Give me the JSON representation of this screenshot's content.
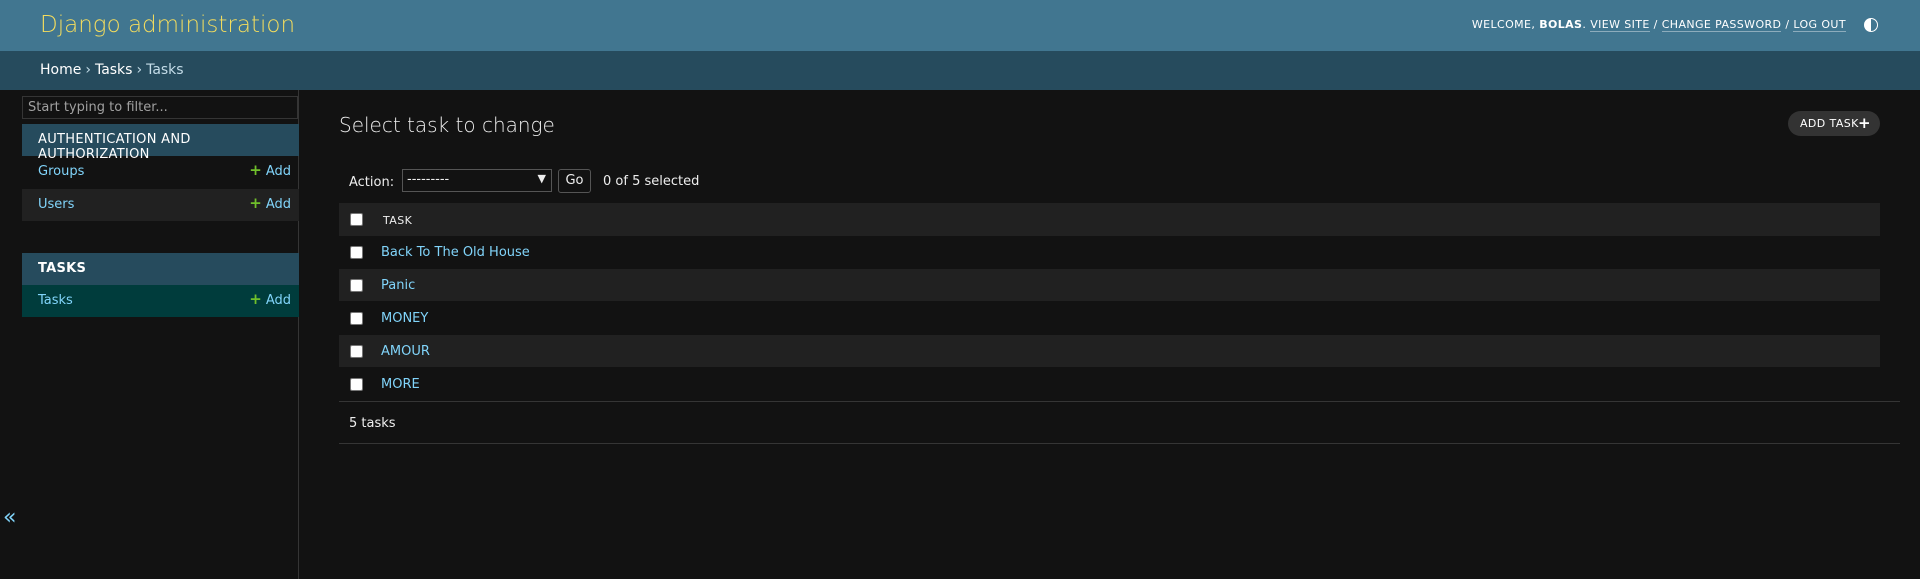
{
  "header": {
    "brand": "Django administration",
    "welcome": "WELCOME, ",
    "username": "BOLAS",
    "view_site": "VIEW SITE",
    "change_password": "CHANGE PASSWORD",
    "log_out": "LOG OUT",
    "separator": " / ",
    "theme_icon": "half-circle-theme-icon"
  },
  "breadcrumbs": [
    "Home",
    "Tasks",
    "Tasks"
  ],
  "breadcrumb_sep": "›",
  "sidebar": {
    "filter_placeholder": "Start typing to filter...",
    "modules": [
      {
        "caption": "AUTHENTICATION AND AUTHORIZATION",
        "models": [
          {
            "name": "Groups",
            "add": "Add"
          },
          {
            "name": "Users",
            "add": "Add"
          }
        ]
      },
      {
        "caption": "TASKS",
        "models": [
          {
            "name": "Tasks",
            "add": "Add",
            "current": true
          }
        ]
      }
    ],
    "collapse_icon": "«"
  },
  "content": {
    "title": "Select task to change",
    "add_button": "ADD TASK",
    "action_label": "Action:",
    "action_selected": "---------",
    "go": "Go",
    "counter": "0 of 5 selected",
    "column_header": "TASK",
    "rows": [
      "Back To The Old House",
      "Panic",
      "MONEY",
      "AMOUR",
      "MORE"
    ],
    "paginator": "5 tasks"
  },
  "colors": {
    "header_bg": "#417690",
    "breadcrumbs_bg": "#264b5d",
    "brand": "#f5dd5d",
    "link": "#81d4fa",
    "add_plus": "#70bf2b",
    "body_bg": "#121212"
  }
}
